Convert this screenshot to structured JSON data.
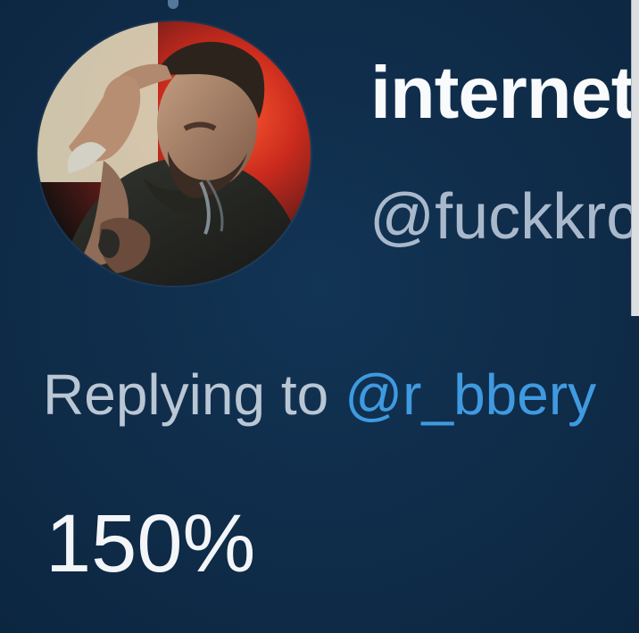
{
  "tweet": {
    "display_name": "internet",
    "handle": "@fuckkrc",
    "reply_prefix": "Replying to",
    "reply_handle": "@r_bbery",
    "text": "150%"
  },
  "colors": {
    "background": "#0f2d4a",
    "link": "#3f9ae0",
    "handle": "#a9b9cb",
    "text": "#f3f5f8"
  },
  "icons": {
    "avatar": "profile-avatar"
  }
}
